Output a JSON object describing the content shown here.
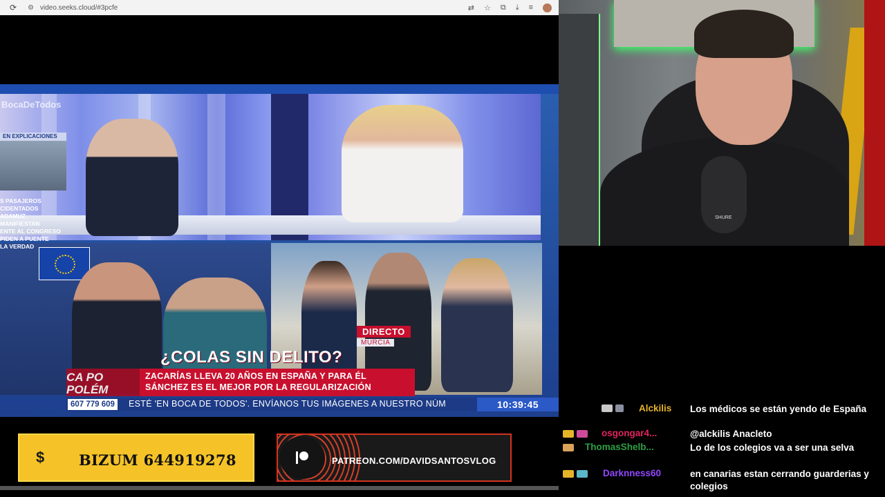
{
  "browser": {
    "url": "video.seeks.cloud/#3pcfe",
    "icons": [
      "reload-icon",
      "site-info-icon",
      "translate-icon",
      "star-icon",
      "extensions-icon",
      "download-icon",
      "playlist-icon",
      "profile-avatar"
    ]
  },
  "broadcast": {
    "watermark": "BocaDeTodos",
    "side_tag": "EN EXPLICACIONES",
    "side_text": "S PASAJEROS\nCIDENTADOS\nADAMUZ\nMANIFIESTAN\nENTE AL CONGRESO\nPIDEN A PUENTE\nLA VERDAD",
    "directo": "DIRECTO",
    "location": "MURCIA",
    "headline": "¿COLAS SIN DELITO?",
    "left_fragment": "CA  PO\nPOLÉM",
    "subhead_line1": "ZACARÍAS LLEVA 20 AÑOS EN ESPAÑA Y PARA ÉL",
    "subhead_line2": "SÁNCHEZ ES EL MEJOR POR LA REGULARIZACIÓN",
    "phone": "607 779 609",
    "ticker": "ESTÉ 'EN BOCA DE TODOS'. ENVÍANOS TUS IMÁGENES A NUESTRO NÚM",
    "clock": "10:39:45"
  },
  "donations": {
    "bizum_symbol": "$",
    "bizum_label": "BIZUM 644919278",
    "patreon_label": "PATREON.COM/DAVIDSANTOSVLOG"
  },
  "webcam": {
    "mic_brand": "SHURE"
  },
  "chat": {
    "messages": [
      {
        "user": "Alckilis",
        "color": "#e6b428",
        "text": "Los médicos se están yendo de España"
      },
      {
        "user": "osgongar4...",
        "color": "#e0245e",
        "text": "@alckilis Anacleto"
      },
      {
        "user": "ThomasShelb...",
        "color": "#2ea043",
        "text": "Lo de los colegios va a ser una selva"
      },
      {
        "user": "Darknness60",
        "color": "#9147ff",
        "text": "en canarias estan cerrando guarderias y colegios"
      }
    ]
  }
}
